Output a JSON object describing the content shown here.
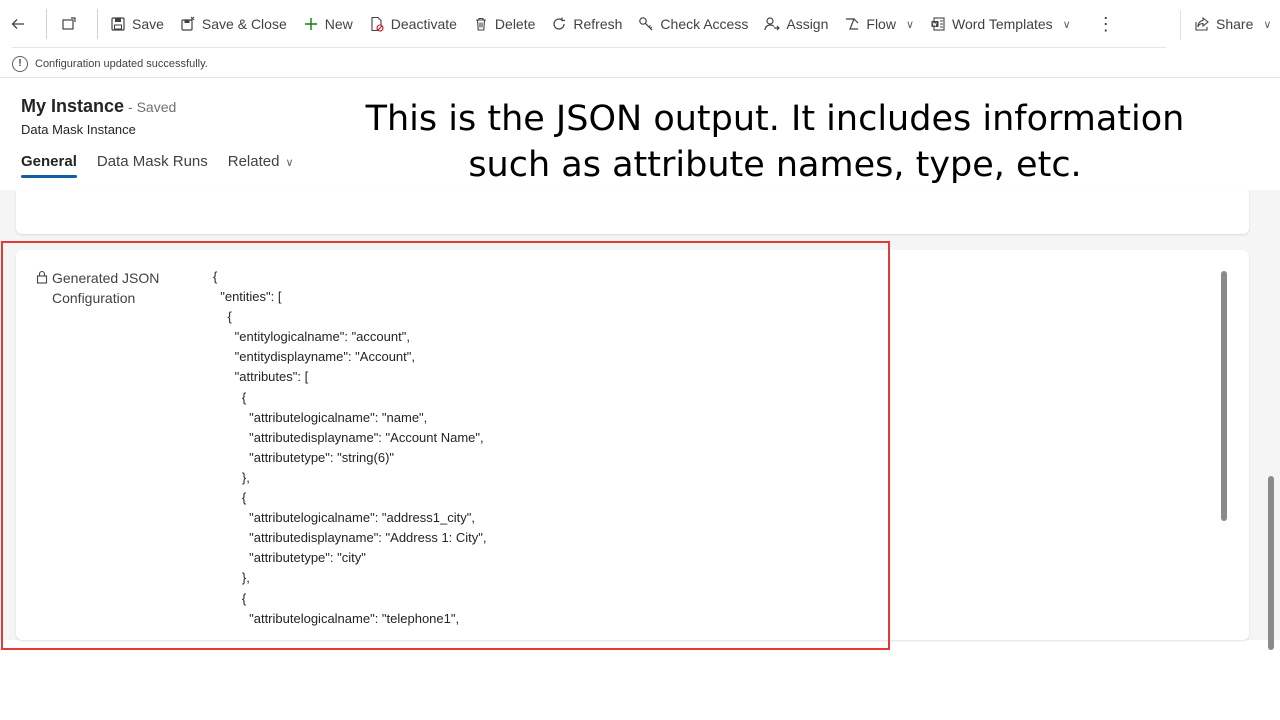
{
  "toolbar": {
    "save": "Save",
    "save_close": "Save & Close",
    "new": "New",
    "deactivate": "Deactivate",
    "delete": "Delete",
    "refresh": "Refresh",
    "check_access": "Check Access",
    "assign": "Assign",
    "flow": "Flow",
    "word_templates": "Word Templates",
    "share": "Share"
  },
  "notification": "Configuration updated successfully.",
  "record": {
    "title": "My Instance",
    "status": "- Saved",
    "entity": "Data Mask Instance"
  },
  "tabs": [
    "General",
    "Data Mask Runs",
    "Related"
  ],
  "overlay_caption": "This is the JSON output. It includes information such as attribute names, type, etc.",
  "field": {
    "label_line1": "Generated JSON",
    "label_line2": "Configuration"
  },
  "json_lines": [
    "{",
    "  \"entities\": [",
    "    {",
    "      \"entitylogicalname\": \"account\",",
    "      \"entitydisplayname\": \"Account\",",
    "      \"attributes\": [",
    "        {",
    "          \"attributelogicalname\": \"name\",",
    "          \"attributedisplayname\": \"Account Name\",",
    "          \"attributetype\": \"string(6)\"",
    "        },",
    "        {",
    "          \"attributelogicalname\": \"address1_city\",",
    "          \"attributedisplayname\": \"Address 1: City\",",
    "          \"attributetype\": \"city\"",
    "        },",
    "        {",
    "          \"attributelogicalname\": \"telephone1\","
  ],
  "colors": {
    "highlight": "#e53935",
    "tab_accent": "#115ea3"
  }
}
